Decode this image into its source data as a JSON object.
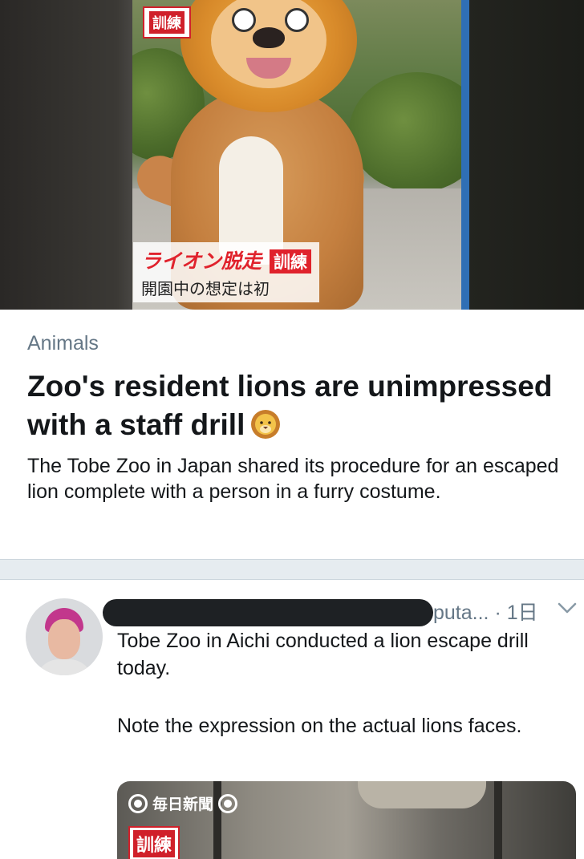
{
  "moment": {
    "hero_tag": "訓練",
    "caption_line1": "ライオン脱走",
    "caption_tag": "訓練",
    "caption_line2": "開園中の想定は初",
    "category": "Animals",
    "headline": "Zoo's resident lions are unimpressed with a staff drill",
    "headline_emoji": "lion-face",
    "summary": "The Tobe Zoo in Japan shared its procedure for an escaped lion complete with a person in a furry costume."
  },
  "tweet": {
    "handle_tail": "puta...",
    "time": "· 1日",
    "menu_icon": "chevron-down-icon",
    "text_para1": "Tobe Zoo in Aichi conducted a lion escape drill today.",
    "text_para2": "Note the expression on the actual lions faces.",
    "media": {
      "brand": "毎日新聞",
      "tag": "訓練"
    }
  },
  "colors": {
    "text_primary": "#14171a",
    "text_secondary": "#657786",
    "divider": "#e6ecf0",
    "caption_red": "#e0222c"
  }
}
